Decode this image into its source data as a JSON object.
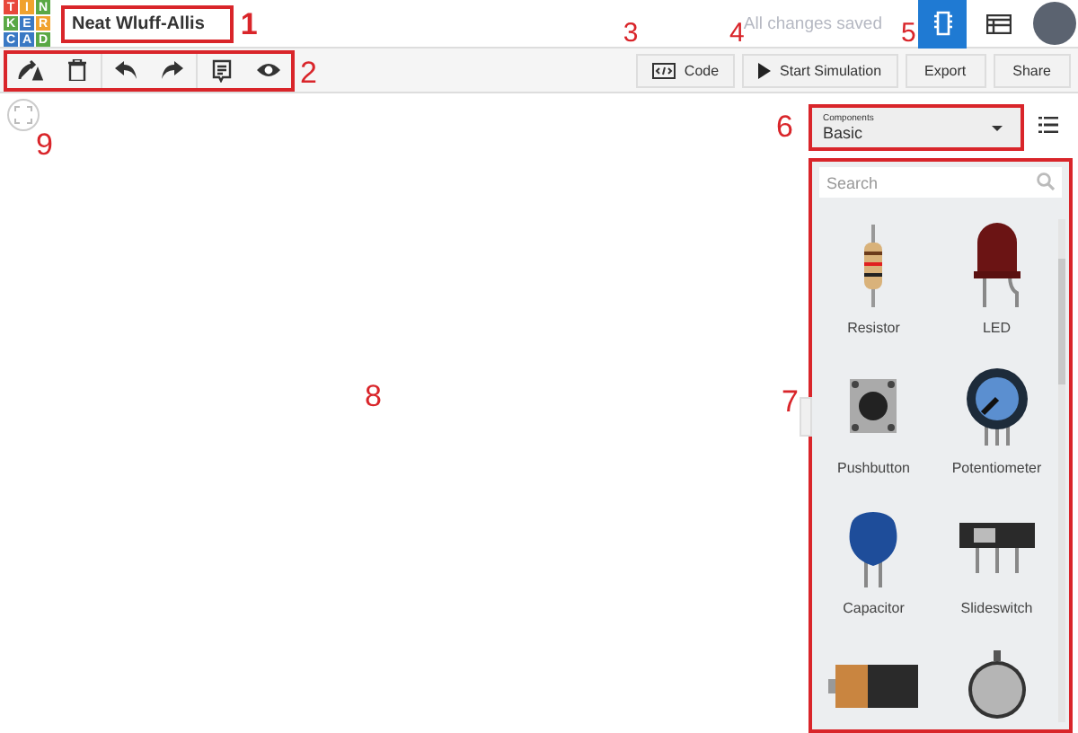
{
  "logo": {
    "letters": [
      "T",
      "I",
      "N",
      "K",
      "E",
      "R",
      "C",
      "A",
      "D"
    ]
  },
  "title": {
    "text": "Neat Wluff-Allis",
    "callout": "1"
  },
  "save_status": "All changes saved",
  "view_buttons": [
    {
      "kind": "circuit",
      "selected": true
    },
    {
      "kind": "schematic",
      "selected": false
    }
  ],
  "toolbar": {
    "callout": "2"
  },
  "actions": [
    {
      "kind": "code",
      "label": "Code",
      "callout": "3"
    },
    {
      "kind": "simulate",
      "label": "Start Simulation",
      "callout": "4"
    },
    {
      "kind": "plain",
      "label": "Export",
      "callout": "5"
    },
    {
      "kind": "plain",
      "label": "Share"
    }
  ],
  "canvas": {
    "callout": "8",
    "fit_callout": "9"
  },
  "components_dropdown": {
    "label": "Components",
    "value": "Basic",
    "callout": "6"
  },
  "components_panel": {
    "callout": "7",
    "search": {
      "placeholder": "Search"
    },
    "items": [
      {
        "kind": "resistor",
        "name": "Resistor"
      },
      {
        "kind": "led",
        "name": "LED"
      },
      {
        "kind": "pushbutton",
        "name": "Pushbutton"
      },
      {
        "kind": "potentiometer",
        "name": "Potentiometer"
      },
      {
        "kind": "capacitor",
        "name": "Capacitor"
      },
      {
        "kind": "slideswitch",
        "name": "Slideswitch"
      },
      {
        "kind": "battery"
      },
      {
        "kind": "coincell"
      }
    ]
  }
}
